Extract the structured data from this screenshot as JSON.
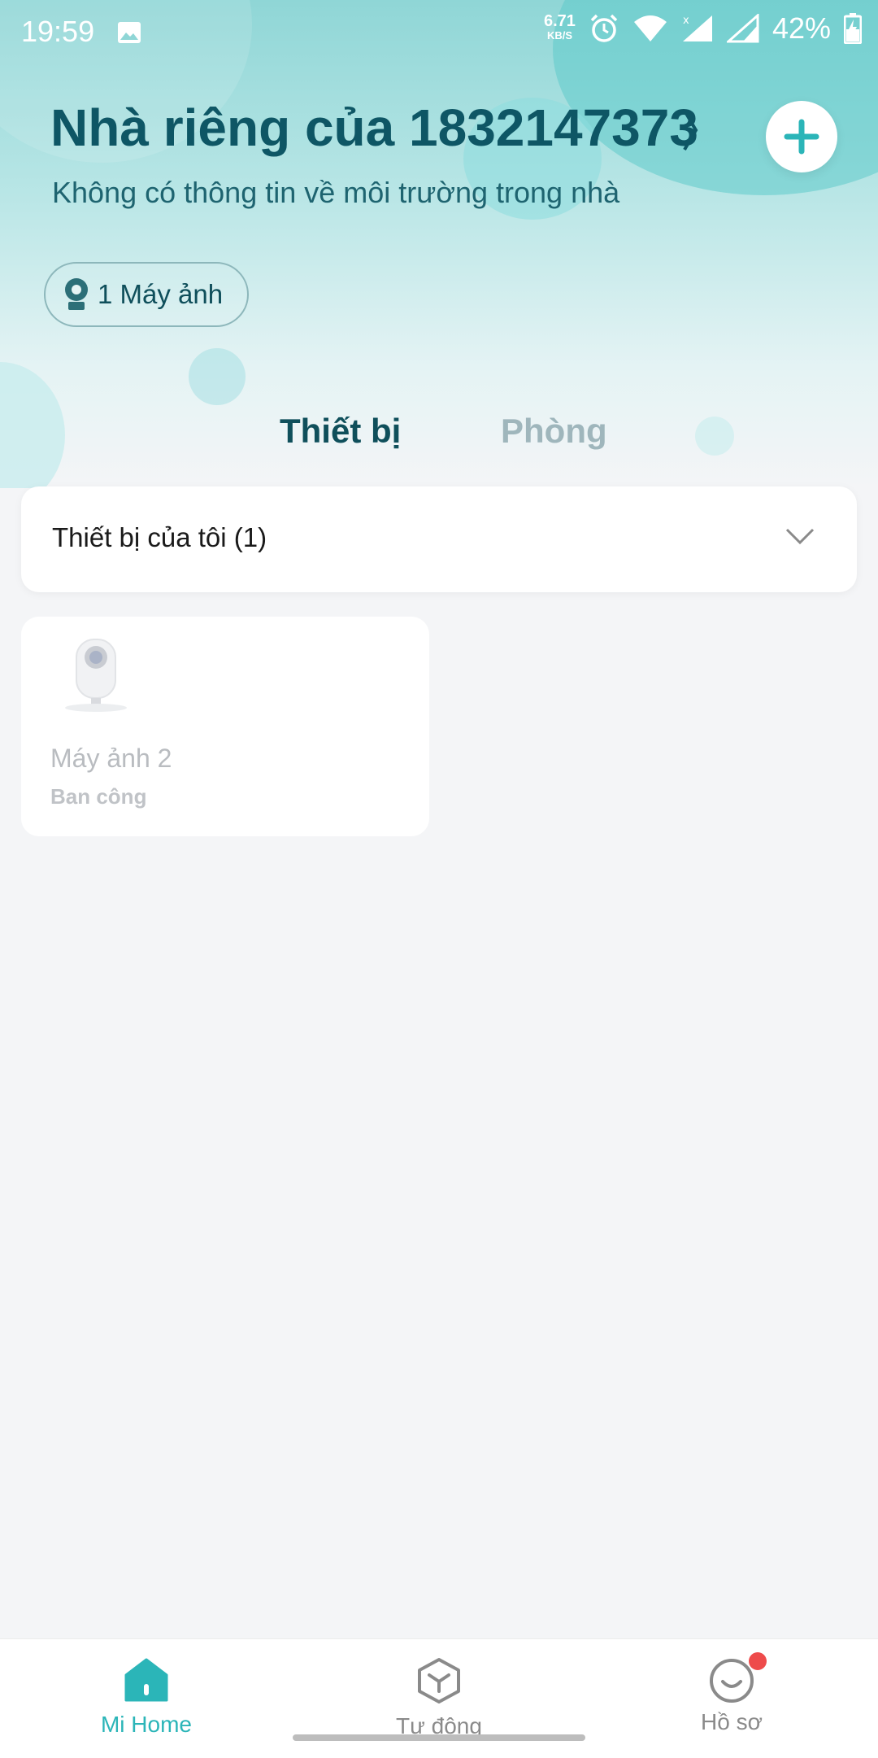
{
  "status_bar": {
    "time": "19:59",
    "net_speed": "6.71",
    "net_unit": "KB/S",
    "battery": "42%"
  },
  "header": {
    "title": "Nhà riêng của 1832147373",
    "subtitle": "Không có thông tin về môi trường trong nhà",
    "chip_label": "1 Máy ảnh"
  },
  "tabs": [
    {
      "label": "Thiết bị",
      "active": true
    },
    {
      "label": "Phòng",
      "active": false
    }
  ],
  "group": {
    "label": "Thiết bị của tôi (1)"
  },
  "devices": [
    {
      "name": "Máy ảnh 2",
      "room": "Ban công",
      "icon": "camera-icon"
    }
  ],
  "bottom_nav": [
    {
      "label": "Mi Home",
      "icon": "home-icon",
      "active": true
    },
    {
      "label": "Tự động",
      "icon": "automation-icon",
      "active": false
    },
    {
      "label": "Hồ sơ",
      "icon": "profile-icon",
      "active": false
    }
  ],
  "colors": {
    "accent": "#2bb5b8",
    "title": "#0e5665",
    "badge": "#ee4b4b"
  }
}
